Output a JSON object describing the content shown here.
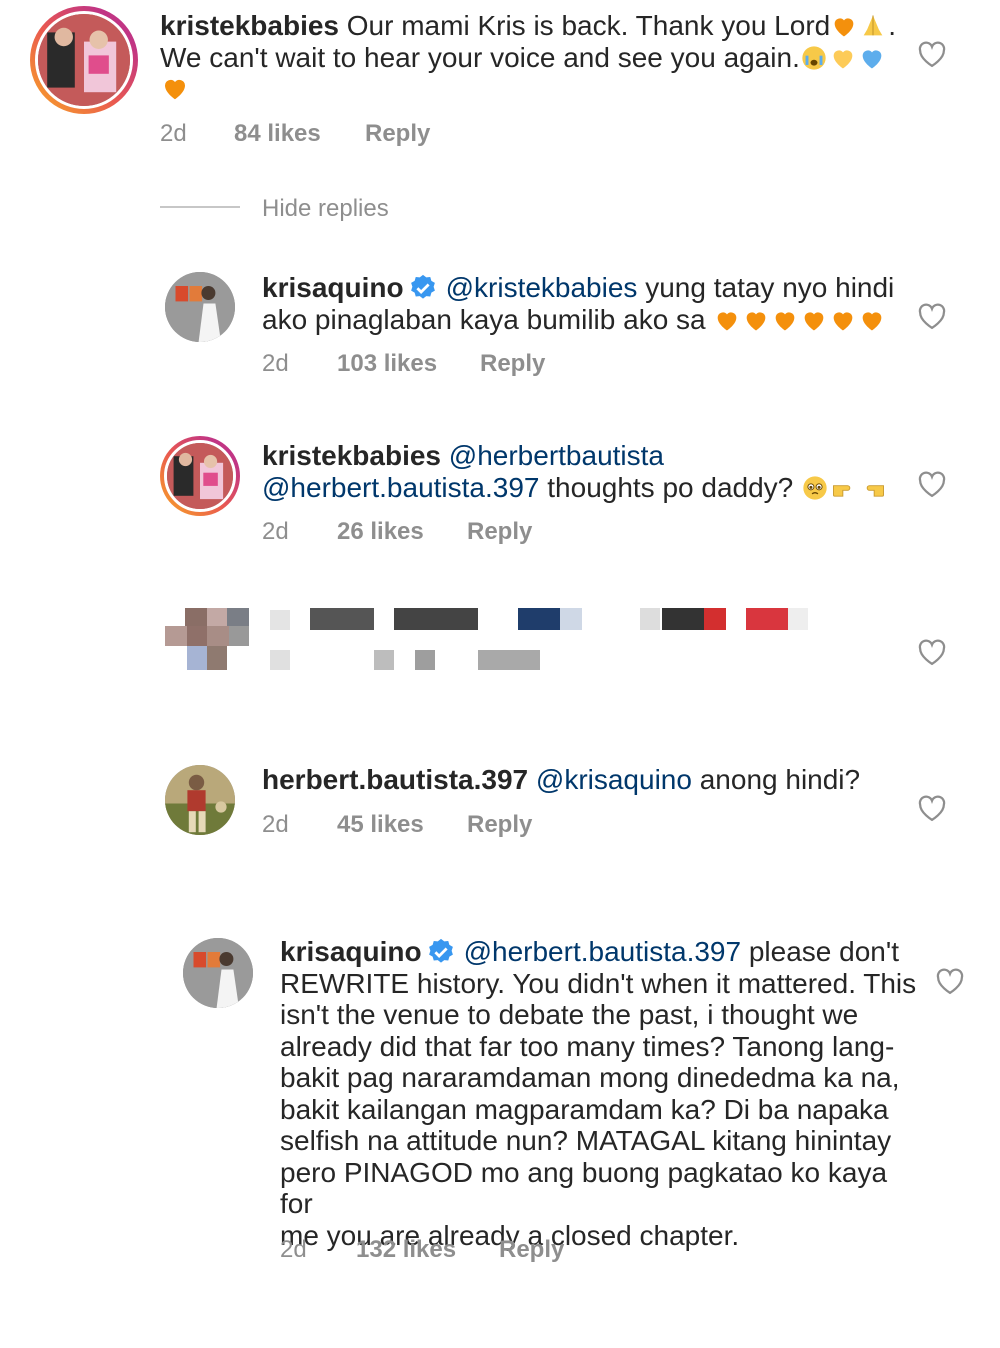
{
  "comments": [
    {
      "username": "kristekbabies",
      "text_line1": "Our mami Kris is back. Thank you Lord",
      "text_line1_end": ".",
      "text_line2": "We can't wait to hear your voice and see you again.",
      "time": "2d",
      "likes": "84 likes",
      "reply": "Reply",
      "avatar_icon": "profile-photo-icon",
      "heart_icon": "heart-outline-icon"
    },
    {
      "username": "krisaquino",
      "mention": "@kristekbabies",
      "text_after_mention": " yung tatay nyo hindi",
      "text_line2": "ako pinaglaban kaya bumilib ako sa ",
      "time": "2d",
      "likes": "103 likes",
      "reply": "Reply"
    },
    {
      "username": "kristekbabies",
      "mention1": "@herbertbautista",
      "mention2": "@herbert.bautista.397",
      "text_after": " thoughts po daddy? ",
      "time": "2d",
      "likes": "26 likes",
      "reply": "Reply"
    },
    {
      "username": "herbert.bautista.397",
      "mention": "@krisaquino",
      "text_after": " anong hindi?",
      "time": "2d",
      "likes": "45 likes",
      "reply": "Reply"
    },
    {
      "username": "krisaquino",
      "mention": "@herbert.bautista.397",
      "lines": [
        " please don't",
        "REWRITE history. You didn't when it mattered. This",
        "isn't the venue to debate the past, i thought we",
        "already did that far too many times? Tanong lang-",
        "bakit pag nararamdaman mong dinededma ka na,",
        "bakit kailangan magparamdam ka? Di ba napaka",
        "selfish na attitude nun? MATAGAL kitang hinintay",
        "pero PINAGOD mo ang buong pagkatao ko kaya for",
        "me you are already a closed chapter."
      ],
      "time": "2d",
      "likes": "132 likes",
      "reply": "Reply"
    }
  ],
  "hide_replies": "Hide replies",
  "colors": {
    "text": "#262626",
    "secondary": "#8e8e8e",
    "mention": "#00376b",
    "verified": "#3897f0",
    "heart_orange": "#f4900c"
  }
}
